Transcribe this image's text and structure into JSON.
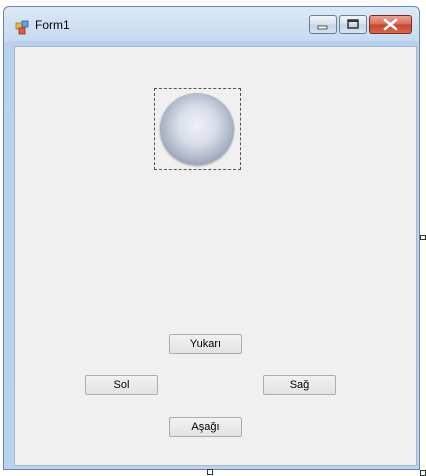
{
  "window": {
    "title": "Form1",
    "app_icon": "windows-form-icon",
    "caption_buttons": [
      "minimize-icon",
      "maximize-icon",
      "close-icon"
    ]
  },
  "form": {
    "picture": "sphere-image",
    "buttons": {
      "up": "Yukarı",
      "left": "Sol",
      "right": "Sağ",
      "down": "Aşağı"
    }
  },
  "colors": {
    "client_background": "#f0f0f0",
    "close_button": "#c7432a",
    "frame": "#b9d1ec"
  }
}
